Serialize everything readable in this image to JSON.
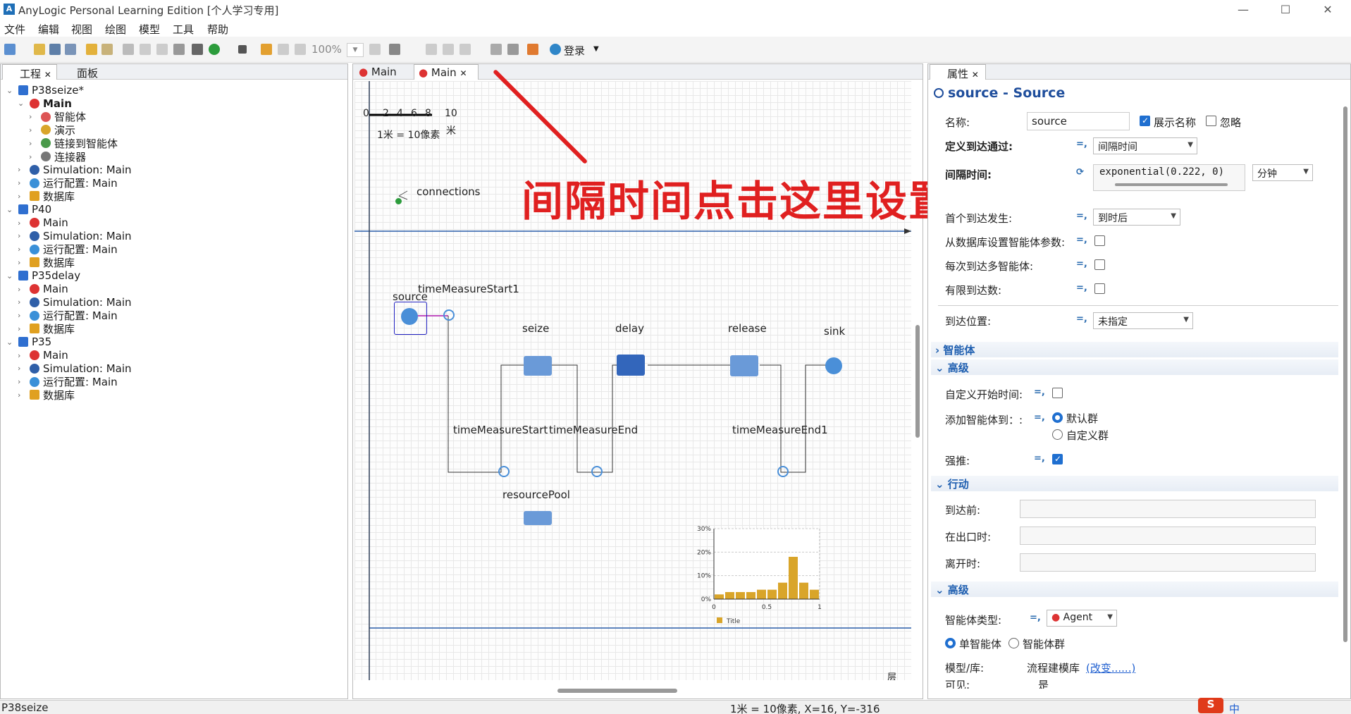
{
  "window": {
    "title": "AnyLogic Personal Learning Edition [个人学习专用]",
    "minimize": "—",
    "maximize": "☐",
    "close": "✕"
  },
  "menu": [
    "文件",
    "编辑",
    "视图",
    "绘图",
    "模型",
    "工具",
    "帮助"
  ],
  "toolbar": {
    "zoom": "100%",
    "login": "登录"
  },
  "left_panel": {
    "tabs": [
      "工程",
      "面板"
    ],
    "tree": [
      {
        "label": "P38seize*",
        "level": 0,
        "bold": false,
        "icon": "model-icon"
      },
      {
        "label": "Main",
        "level": 1,
        "bold": true,
        "icon": "agent-icon"
      },
      {
        "label": "智能体",
        "level": 2,
        "bold": false,
        "icon": "agents-icon"
      },
      {
        "label": "演示",
        "level": 2,
        "bold": false,
        "icon": "presentation-icon"
      },
      {
        "label": "链接到智能体",
        "level": 2,
        "bold": false,
        "icon": "links-icon"
      },
      {
        "label": "连接器",
        "level": 2,
        "bold": false,
        "icon": "connector-icon"
      },
      {
        "label": "Simulation: Main",
        "level": 1,
        "bold": false,
        "icon": "simulation-icon"
      },
      {
        "label": "运行配置: Main",
        "level": 1,
        "bold": false,
        "icon": "run-config-icon"
      },
      {
        "label": "数据库",
        "level": 1,
        "bold": false,
        "icon": "database-icon"
      },
      {
        "label": "P40",
        "level": 0,
        "bold": false,
        "icon": "model-icon"
      },
      {
        "label": "Main",
        "level": 1,
        "bold": false,
        "icon": "agent-icon"
      },
      {
        "label": "Simulation: Main",
        "level": 1,
        "bold": false,
        "icon": "simulation-icon"
      },
      {
        "label": "运行配置: Main",
        "level": 1,
        "bold": false,
        "icon": "run-config-icon"
      },
      {
        "label": "数据库",
        "level": 1,
        "bold": false,
        "icon": "database-icon"
      },
      {
        "label": "P35delay",
        "level": 0,
        "bold": false,
        "icon": "model-icon"
      },
      {
        "label": "Main",
        "level": 1,
        "bold": false,
        "icon": "agent-icon"
      },
      {
        "label": "Simulation: Main",
        "level": 1,
        "bold": false,
        "icon": "simulation-icon"
      },
      {
        "label": "运行配置: Main",
        "level": 1,
        "bold": false,
        "icon": "run-config-icon"
      },
      {
        "label": "数据库",
        "level": 1,
        "bold": false,
        "icon": "database-icon"
      },
      {
        "label": "P35",
        "level": 0,
        "bold": false,
        "icon": "model-icon"
      },
      {
        "label": "Main",
        "level": 1,
        "bold": false,
        "icon": "agent-icon"
      },
      {
        "label": "Simulation: Main",
        "level": 1,
        "bold": false,
        "icon": "simulation-icon"
      },
      {
        "label": "运行配置: Main",
        "level": 1,
        "bold": false,
        "icon": "run-config-icon"
      },
      {
        "label": "数据库",
        "level": 1,
        "bold": false,
        "icon": "database-icon"
      }
    ]
  },
  "editor": {
    "tabs": [
      "Main",
      "Main"
    ],
    "scale": {
      "ticks": [
        "0",
        "2",
        "4",
        "6",
        "8",
        "10"
      ],
      "unit": "米",
      "caption": "1米 = 10像素"
    },
    "connections_label": "connections",
    "blocks": {
      "source": "source",
      "timeMeasureStart1": "timeMeasureStart1",
      "seize": "seize",
      "delay": "delay",
      "release": "release",
      "sink": "sink",
      "timeMeasureStart": "timeMeasureStart",
      "timeMeasureEnd": "timeMeasureEnd",
      "timeMeasureEnd1": "timeMeasureEnd1",
      "resourcePool": "resourcePool"
    },
    "annotation": "间隔时间点击这里设置",
    "layer_label": "层"
  },
  "chart_data": {
    "type": "bar",
    "title": "Title",
    "ylim": [
      0,
      30
    ],
    "xlim": [
      0,
      1
    ],
    "ytick_labels": [
      "0%",
      "10%",
      "20%",
      "30%"
    ],
    "xtick_labels": [
      "0",
      "0.5",
      "1"
    ],
    "values": [
      2,
      3,
      3,
      3,
      4,
      4,
      7,
      18,
      7,
      4
    ],
    "color": "#d9a52a"
  },
  "properties": {
    "tab": "属性",
    "header": "source - Source",
    "name_label": "名称:",
    "name_value": "source",
    "show_name": "展示名称",
    "ignore": "忽略",
    "arrival_label": "定义到达通过:",
    "arrival_value": "间隔时间",
    "interval_label": "间隔时间:",
    "interval_value": "exponential(0.222, 0)",
    "interval_unit": "分钟",
    "first_label": "首个到达发生:",
    "first_value": "到时后",
    "db_label": "从数据库设置智能体参数:",
    "multi_label": "每次到达多智能体:",
    "limited_label": "有限到达数:",
    "location_label": "到达位置:",
    "location_value": "未指定",
    "sec_agent": "智能体",
    "sec_advanced": "高级",
    "custom_start_label": "自定义开始时间:",
    "add_to_label": "添加智能体到：:",
    "default_pop": "默认群",
    "custom_pop": "自定义群",
    "force_label": "强推:",
    "sec_action": "行动",
    "before_arrive": "到达前:",
    "on_exit": "在出口时:",
    "on_leave": "离开时:",
    "sec_advanced2": "高级",
    "agent_type_label": "智能体类型:",
    "agent_type_value": "Agent",
    "single_agent": "单智能体",
    "agent_pop": "智能体群",
    "model_lib_label": "模型/库:",
    "model_lib_value": "流程建模库",
    "change_link": "(改变......)",
    "visible_label": "可见:",
    "visible_value": "是"
  },
  "statusbar": {
    "left": "P38seize",
    "center": "1米 = 10像素, X=16,  Y=-316"
  },
  "ime": {
    "logo": "S",
    "lang": "中"
  }
}
